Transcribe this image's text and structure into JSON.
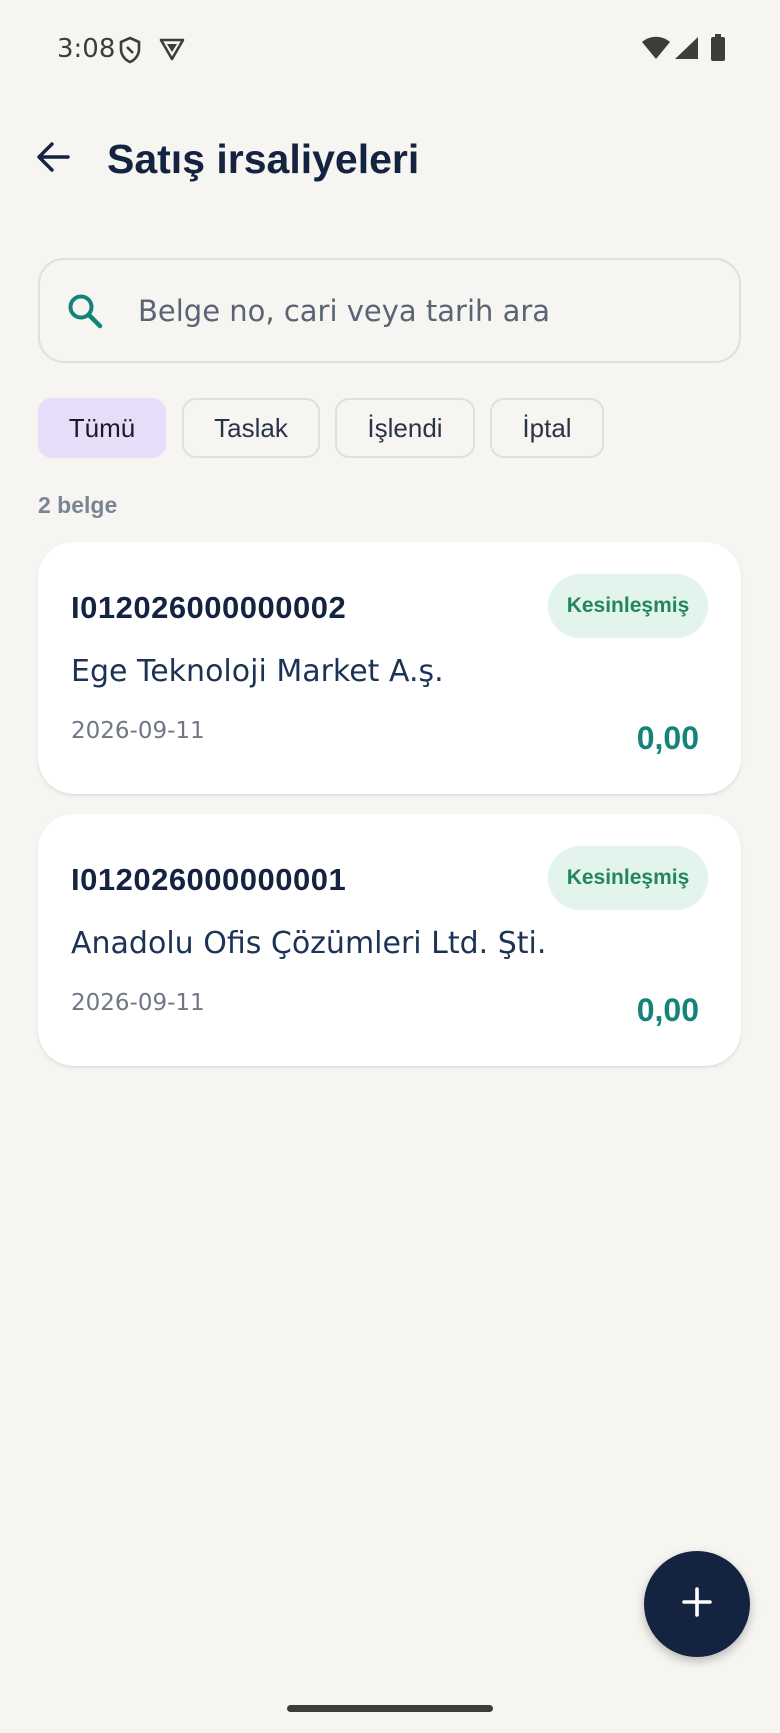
{
  "status_bar": {
    "time": "3:08",
    "left_icons": [
      "shield-icon",
      "vpn-badge-icon"
    ],
    "right_icons": [
      "wifi-icon",
      "cell-signal-icon",
      "battery-icon"
    ]
  },
  "header": {
    "title": "Satış irsaliyeleri",
    "back_icon": "arrow-left-icon"
  },
  "search": {
    "placeholder": "Belge no, cari veya tarih ara",
    "value": ""
  },
  "filters": [
    {
      "label": "Tümü",
      "selected": true
    },
    {
      "label": "Taslak",
      "selected": false
    },
    {
      "label": "İşlendi",
      "selected": false
    },
    {
      "label": "İptal",
      "selected": false
    }
  ],
  "count_label": "2 belge",
  "documents": [
    {
      "doc_no": "I012026000000002",
      "party": "Ege Teknoloji Market A.ş.",
      "date": "2026-09-11",
      "amount": "0,00",
      "status": "Kesinleşmiş"
    },
    {
      "doc_no": "I012026000000001",
      "party": "Anadolu Ofis Çözümleri Ltd. Şti.",
      "date": "2026-09-11",
      "amount": "0,00",
      "status": "Kesinleşmiş"
    }
  ],
  "fab": {
    "icon": "plus-icon"
  },
  "colors": {
    "primary": "#14233f",
    "accent_teal": "#14847a",
    "chip_selected": "#e6def8",
    "badge_bg": "#e3f4ec",
    "badge_text": "#23875c",
    "background": "#f6f5f1"
  }
}
